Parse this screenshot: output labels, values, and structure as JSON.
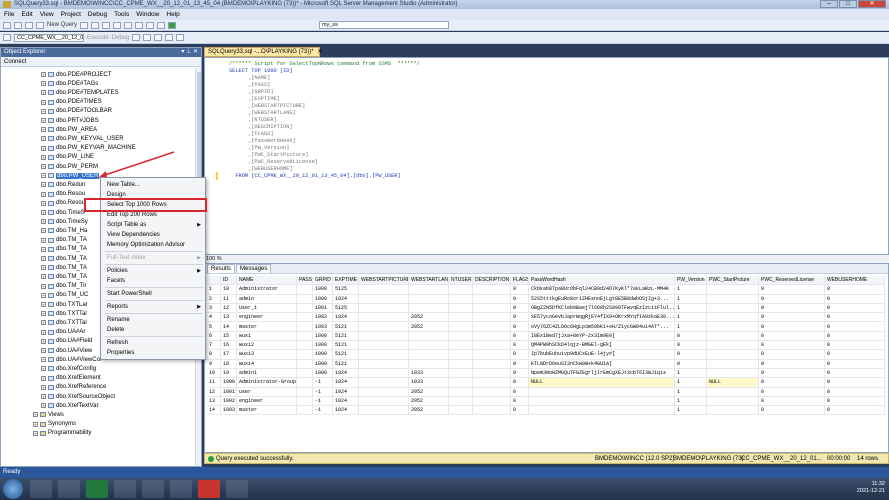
{
  "window": {
    "title": "SQLQuery33.sql - BMDEMO\\WINCC\\CC_CPME_WX__20_12_01_13_45_04 (BMDEMO\\PLAYKING (73))* - Microsoft SQL Server Management Studio (Administrator)"
  },
  "menu": [
    "File",
    "Edit",
    "View",
    "Project",
    "Debug",
    "Tools",
    "Window",
    "Help"
  ],
  "toolbar": {
    "new_query": "New Query",
    "database_select": "CC_CPME_WX__20_12_01...",
    "execute": "Execute",
    "debug": "Debug",
    "search_box": "my_ss"
  },
  "object_explorer": {
    "title": "Object Explorer",
    "connect": "Connect",
    "tree": [
      {
        "label": "dbo.PDE#PROJECT",
        "kind": "table"
      },
      {
        "label": "dbo.PDE#TAGs",
        "kind": "table"
      },
      {
        "label": "dbo.PDE#TEMPLATES",
        "kind": "table"
      },
      {
        "label": "dbo.PDE#TIMES",
        "kind": "table"
      },
      {
        "label": "dbo.PDE#TOOLBAR",
        "kind": "table"
      },
      {
        "label": "dbo.PRT#JOBS",
        "kind": "table"
      },
      {
        "label": "dbo.PW_AREA",
        "kind": "table"
      },
      {
        "label": "dbo.PW_KEYVAL_USER",
        "kind": "table"
      },
      {
        "label": "dbo.PW_KEYVAR_MACHINE",
        "kind": "table"
      },
      {
        "label": "dbo.PW_LINE",
        "kind": "table"
      },
      {
        "label": "dbo.PW_PERM",
        "kind": "table"
      },
      {
        "label": "dbo.PW_USER",
        "kind": "table",
        "selected": true
      },
      {
        "label": "dbo.Redun",
        "kind": "table"
      },
      {
        "label": "dbo.Resou",
        "kind": "table"
      },
      {
        "label": "dbo.Resou",
        "kind": "table"
      },
      {
        "label": "dbo.TimeS",
        "kind": "table"
      },
      {
        "label": "dbo.TimeSy",
        "kind": "table"
      },
      {
        "label": "dbo.TM_Ha",
        "kind": "table"
      },
      {
        "label": "dbo.TM_TA",
        "kind": "table"
      },
      {
        "label": "dbo.TM_TA",
        "kind": "table"
      },
      {
        "label": "dbo.TM_TA",
        "kind": "table"
      },
      {
        "label": "dbo.TM_TA",
        "kind": "table"
      },
      {
        "label": "dbo.TM_TA",
        "kind": "table"
      },
      {
        "label": "dbo.TM_Tir",
        "kind": "table"
      },
      {
        "label": "dbo.TM_UC",
        "kind": "table"
      },
      {
        "label": "dbo.TXTLar",
        "kind": "table"
      },
      {
        "label": "dbo.TXTTal",
        "kind": "table"
      },
      {
        "label": "dbo.TXTTal",
        "kind": "table"
      },
      {
        "label": "dbo.UA#Ar",
        "kind": "table"
      },
      {
        "label": "dbo.UA#Field",
        "kind": "table"
      },
      {
        "label": "dbo.UA#View",
        "kind": "table"
      },
      {
        "label": "dbo.UA#ViewCol",
        "kind": "table"
      },
      {
        "label": "dbo.XrefConfig",
        "kind": "table"
      },
      {
        "label": "dbo.XrefElement",
        "kind": "table"
      },
      {
        "label": "dbo.XrefReference",
        "kind": "table"
      },
      {
        "label": "dbo.XrefSourceObject",
        "kind": "table"
      },
      {
        "label": "dbo.XrefTextVar",
        "kind": "table"
      },
      {
        "label": "Views",
        "kind": "folder"
      },
      {
        "label": "Synonyms",
        "kind": "folder"
      },
      {
        "label": "Programmability",
        "kind": "folder"
      }
    ]
  },
  "context_menu": [
    {
      "label": "New Table...",
      "type": "item"
    },
    {
      "label": "Design",
      "type": "item"
    },
    {
      "label": "Select Top 1000 Rows",
      "type": "item",
      "highlight": true
    },
    {
      "label": "Edit Top 200 Rows",
      "type": "item"
    },
    {
      "label": "Script Table as",
      "type": "submenu"
    },
    {
      "label": "View Dependencies",
      "type": "item"
    },
    {
      "label": "Memory Optimization Advisor",
      "type": "item"
    },
    {
      "label": "",
      "type": "sep"
    },
    {
      "label": "Full-Text index",
      "type": "submenu",
      "disabled": true
    },
    {
      "label": "",
      "type": "sep"
    },
    {
      "label": "Policies",
      "type": "submenu"
    },
    {
      "label": "Facets",
      "type": "item"
    },
    {
      "label": "",
      "type": "sep"
    },
    {
      "label": "Start PowerShell",
      "type": "item"
    },
    {
      "label": "",
      "type": "sep"
    },
    {
      "label": "Reports",
      "type": "submenu"
    },
    {
      "label": "",
      "type": "sep"
    },
    {
      "label": "Rename",
      "type": "item"
    },
    {
      "label": "Delete",
      "type": "item"
    },
    {
      "label": "",
      "type": "sep"
    },
    {
      "label": "Refresh",
      "type": "item"
    },
    {
      "label": "Properties",
      "type": "item"
    }
  ],
  "document_tab": "SQLQuery33.sql -...O\\PLAYKING (73))*",
  "code_lines": [
    {
      "text": "/****** Script for SelectTopNRows command from SSMS  ******/",
      "style": "cm"
    },
    {
      "text": "SELECT TOP 1000 [ID]",
      "style": "kw"
    },
    {
      "text": "      ,[NAME]",
      "style": "gy"
    },
    {
      "text": "      ,[PASS]",
      "style": "gy"
    },
    {
      "text": "      ,[GRPID]",
      "style": "gy"
    },
    {
      "text": "      ,[EXPTIME]",
      "style": "gy"
    },
    {
      "text": "      ,[WEBSTARTPICTURE]",
      "style": "gy"
    },
    {
      "text": "      ,[WEBSTARTLANG]",
      "style": "gy"
    },
    {
      "text": "      ,[NTUSER]",
      "style": "gy"
    },
    {
      "text": "      ,[DESCRIPTION]",
      "style": "gy"
    },
    {
      "text": "      ,[FLAGS]",
      "style": "gy"
    },
    {
      "text": "      ,[PassWordHash]",
      "style": "gy"
    },
    {
      "text": "      ,[PW_Version]",
      "style": "gy"
    },
    {
      "text": "      ,[PWC_StartPicture]",
      "style": "gy"
    },
    {
      "text": "      ,[PWC_ReservedLicense]",
      "style": "gy"
    },
    {
      "text": "      ,[WEBUSERHOME]",
      "style": "gy"
    },
    {
      "text": "  FROM [CC_CPME_WX__20_12_01_13_45_04].[dbo].[PW_USER]",
      "style": "kw"
    }
  ],
  "zoom": "100 %",
  "results": {
    "tabs": [
      "Results",
      "Messages"
    ],
    "columns": [
      "",
      "ID",
      "NAME",
      "PASS",
      "GRPID",
      "EXPTIME",
      "WEBSTARTPICTURE",
      "WEBSTARTLANG",
      "NTUSER",
      "DESCRIPTION",
      "FLAGS",
      "PassWordHash",
      "PW_Version",
      "PWC_StartPicture",
      "PWC_ReservedLicense",
      "WEBUSERHOME"
    ],
    "rows": [
      [
        "1",
        "10",
        "Administrator",
        "",
        "1000",
        "5125",
        "",
        "",
        "",
        "",
        "0",
        "Ckbkab8Tpa8UrObFql24CB9d24D7KyKl*7akLaRzL-MM4K",
        "1",
        "",
        "0",
        "0"
      ],
      [
        "2",
        "11",
        "admin",
        "",
        "1000",
        "1024",
        "",
        "",
        "",
        "",
        "0",
        "52S5tttkgEuRo8or1ZHEsnoEjLgtGE5B8dwbOSjIg+3...",
        "1",
        "",
        "0",
        "0"
      ],
      [
        "3",
        "12",
        "User_1",
        "",
        "1001",
        "5125",
        "",
        "",
        "",
        "",
        "0",
        "OBgZ2N5DfKCleb0Baej7l668h2S999TFwvqEzIzcitFlul...",
        "1",
        "",
        "0",
        "0"
      ],
      [
        "4",
        "13",
        "engineer",
        "",
        "1002",
        "1024",
        "",
        "2052",
        "",
        "",
        "0",
        "xE57ycoGevbJaprWqgRjEY4fIX9+OKrxMYqfIA9zkaE30...",
        "1",
        "",
        "0",
        "0"
      ],
      [
        "5",
        "14",
        "master",
        "",
        "1003",
        "5121",
        "",
        "2052",
        "",
        "",
        "0",
        "oVy76ZC4ZLO6c6HgLp3m59bK1+sH/Z1ycGW04u14AT*...",
        "1",
        "",
        "0",
        "0"
      ],
      [
        "6",
        "15",
        "wuxi",
        "",
        "1000",
        "5121",
        "",
        "",
        "",
        "",
        "0",
        "I8Ex1Bed7jJxa+8eYP-2x3Im9E0[",
        "0",
        "",
        "0",
        "0"
      ],
      [
        "7",
        "16",
        "wuxi2",
        "",
        "1000",
        "5121",
        "",
        "",
        "",
        "",
        "0",
        "QM4PW9hSCkD4lqjz-BMGEl-gEk[",
        "0",
        "",
        "0",
        "0"
      ],
      [
        "8",
        "17",
        "wuxi3",
        "",
        "1000",
        "5121",
        "",
        "",
        "",
        "",
        "0",
        "Ip7bubEuhuivp9dUCxEuE-l4jy#[",
        "0",
        "",
        "0",
        "0"
      ],
      [
        "9",
        "18",
        "wuxi4",
        "",
        "1000",
        "5121",
        "",
        "",
        "",
        "",
        "0",
        "KTLNDrD6euSI3nCkw0W+k4GU1A[",
        "0",
        "",
        "0",
        "0"
      ],
      [
        "10",
        "19",
        "admin1",
        "",
        "1000",
        "1024",
        "",
        "1033",
        "",
        "",
        "0",
        "Npem3NoHZMGQuTFGZEgrljIrEmCgXEJt3cbT6I3WJ1qis",
        "1",
        "",
        "0",
        "0"
      ],
      [
        "11",
        "1000",
        "Administrator-Group",
        "",
        "-1",
        "1024",
        "",
        "1033",
        "",
        "",
        "0",
        "NULL",
        "1",
        "NULL",
        "0",
        "0"
      ],
      [
        "12",
        "1001",
        "user",
        "",
        "-1",
        "1024",
        "",
        "2052",
        "",
        "",
        "0",
        "",
        "1",
        "",
        "0",
        "0"
      ],
      [
        "13",
        "1002",
        "engineer",
        "",
        "-1",
        "1024",
        "",
        "2052",
        "",
        "",
        "0",
        "",
        "1",
        "",
        "0",
        "0"
      ],
      [
        "14",
        "1003",
        "master",
        "",
        "-1",
        "1024",
        "",
        "2052",
        "",
        "",
        "0",
        "",
        "1",
        "",
        "0",
        "0"
      ]
    ]
  },
  "status": {
    "message": "Query executed successfully.",
    "server": "BMDEMO\\WINCC (12.0 SP2)",
    "login": "BMDEMO\\PLAYKING (73)",
    "database": "CC_CPME_WX__20_12_01...",
    "time": "00:00:00",
    "rows": "14 rows"
  },
  "ready": "Ready",
  "clock": {
    "time": "11:32",
    "date": "2021-12-21"
  }
}
